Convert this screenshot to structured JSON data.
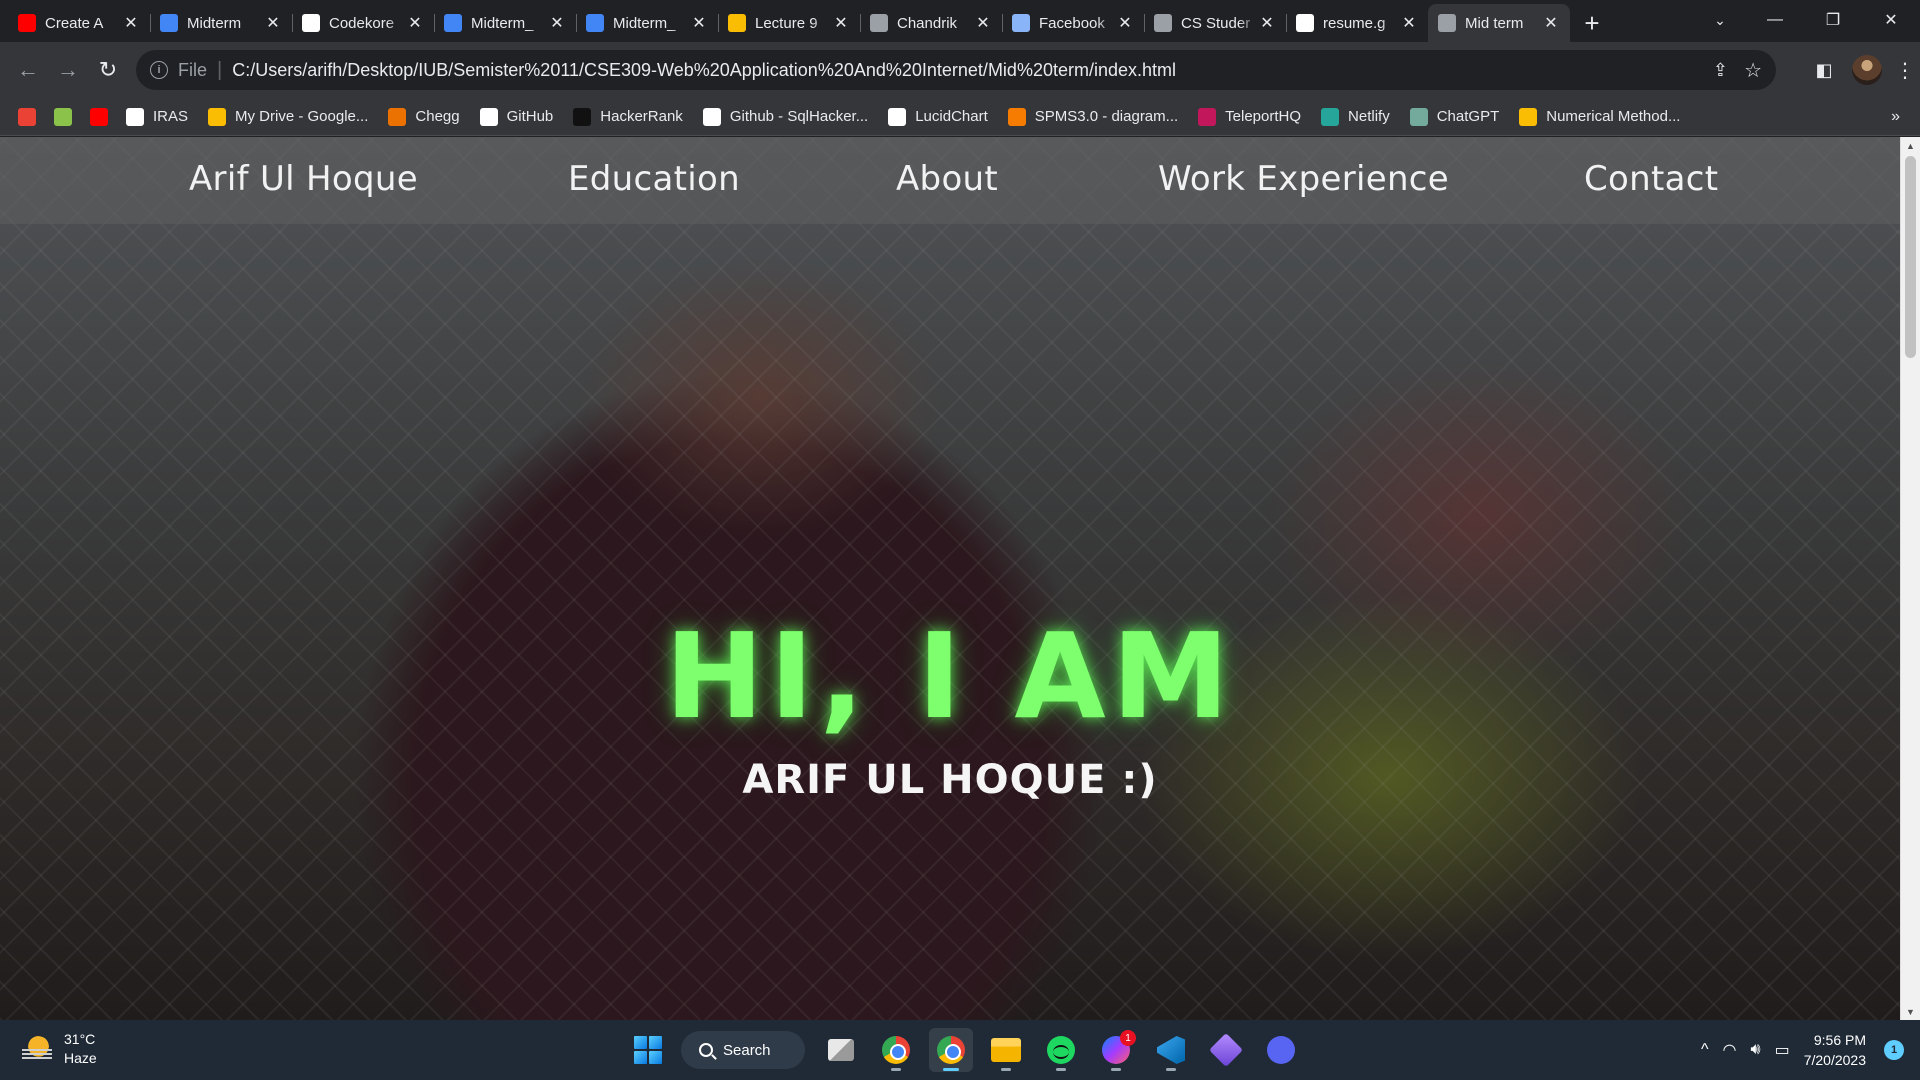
{
  "browser": {
    "tabs": [
      {
        "title": "Create A",
        "icon": "youtube-icon",
        "color": "#ff0000"
      },
      {
        "title": "Midterm",
        "icon": "classroom-icon",
        "color": "#4285f4"
      },
      {
        "title": "Codekore",
        "icon": "github-icon",
        "color": "#ffffff"
      },
      {
        "title": "Midterm_",
        "icon": "docs-icon",
        "color": "#4285f4"
      },
      {
        "title": "Midterm_",
        "icon": "docs-icon",
        "color": "#4285f4"
      },
      {
        "title": "Lecture 9",
        "icon": "slides-icon",
        "color": "#fbbc04"
      },
      {
        "title": "Chandrik",
        "icon": "globe-c-icon",
        "color": "#9aa0a6"
      },
      {
        "title": "Facebook",
        "icon": "flag-icon",
        "color": "#8ab4f8"
      },
      {
        "title": "CS Studer",
        "icon": "chatgpt-icon",
        "color": "#9aa0a6"
      },
      {
        "title": "resume.g",
        "icon": "github-icon",
        "color": "#ffffff"
      },
      {
        "title": "Mid term",
        "icon": "globe-icon",
        "color": "#9aa0a6",
        "active": true
      }
    ],
    "address": {
      "scheme": "File",
      "url": "C:/Users/arifh/Desktop/IUB/Semister%2011/CSE309-Web%20Application%20And%20Internet/Mid%20term/index.html"
    },
    "bookmarks": [
      {
        "label": "",
        "icon": "gmail-icon",
        "color": "#ea4335"
      },
      {
        "label": "",
        "icon": "photos-icon",
        "color": "#8bc34a"
      },
      {
        "label": "",
        "icon": "youtube-icon",
        "color": "#ff0000"
      },
      {
        "label": "IRAS",
        "icon": "iras-icon",
        "color": "#ffffff"
      },
      {
        "label": "My Drive - Google...",
        "icon": "drive-icon",
        "color": "#fbbc04"
      },
      {
        "label": "Chegg",
        "icon": "chegg-icon",
        "color": "#eb7100"
      },
      {
        "label": "GitHub",
        "icon": "github-icon",
        "color": "#ffffff"
      },
      {
        "label": "HackerRank",
        "icon": "hackerrank-icon",
        "color": "#111111"
      },
      {
        "label": "Github - SqlHacker...",
        "icon": "github-icon",
        "color": "#ffffff"
      },
      {
        "label": "LucidChart",
        "icon": "lucidchart-icon",
        "color": "#ffffff"
      },
      {
        "label": "SPMS3.0 - diagram...",
        "icon": "spms-icon",
        "color": "#f57c00"
      },
      {
        "label": "TeleportHQ",
        "icon": "teleporthq-icon",
        "color": "#c2185b"
      },
      {
        "label": "Netlify",
        "icon": "netlify-icon",
        "color": "#26a69a"
      },
      {
        "label": "ChatGPT",
        "icon": "chatgpt-icon",
        "color": "#74aa9c"
      },
      {
        "label": "Numerical Method...",
        "icon": "drive-icon",
        "color": "#fbbc04"
      }
    ],
    "bookmarks_more": "»"
  },
  "page": {
    "nav": {
      "brand": "Arif Ul Hoque",
      "education": "Education",
      "about": "About",
      "work": "Work Experience",
      "contact": "Contact"
    },
    "headline": "HI, I AM",
    "subline": "ARIF UL HOQUE :)",
    "accent_color": "#7dff6e"
  },
  "taskbar": {
    "weather": {
      "temp": "31°C",
      "condition": "Haze"
    },
    "search_label": "Search",
    "messenger_badge": "1",
    "clock": {
      "time": "9:56 PM",
      "date": "7/20/2023"
    },
    "notifications": "1"
  }
}
